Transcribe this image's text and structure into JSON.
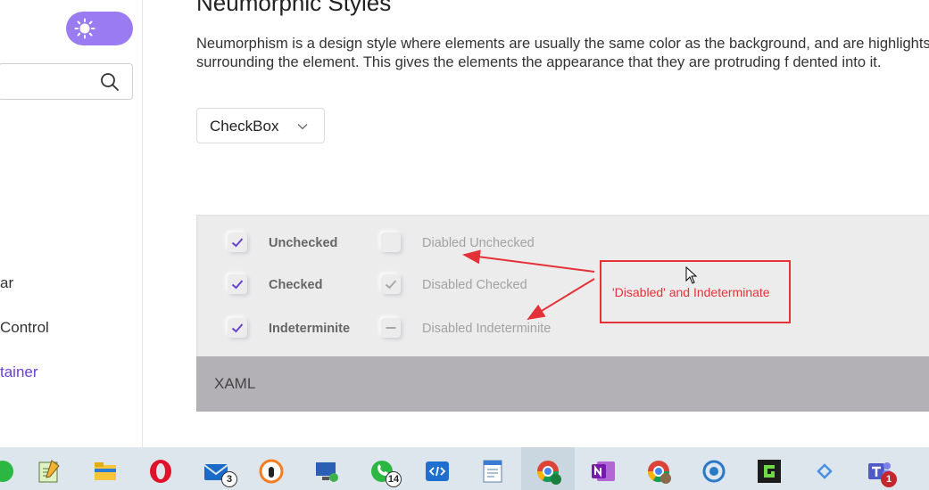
{
  "sidebar": {
    "search": {
      "placeholder": "",
      "value": ""
    },
    "items": [
      {
        "label": "ar"
      },
      {
        "label": "Control"
      },
      {
        "label": "tainer"
      }
    ]
  },
  "main": {
    "title": "Neumorphic Styles",
    "description": "Neumorphism is a design style where elements are usually the same color as the background, and are highlights surrounding the element. This gives the elements the appearance that they are protruding f dented into it.",
    "dropdown": {
      "selected": "CheckBox"
    }
  },
  "checkboxes": {
    "enabled": [
      {
        "label": "Unchecked",
        "state": "checked"
      },
      {
        "label": "Checked",
        "state": "checked"
      },
      {
        "label": "Indeterminite",
        "state": "checked"
      }
    ],
    "disabled": [
      {
        "label": "Diabled Unchecked",
        "state": "unchecked"
      },
      {
        "label": "Disabled Checked",
        "state": "checked"
      },
      {
        "label": "Disabled Indeterminite",
        "state": "indeterminate"
      }
    ]
  },
  "xaml": {
    "label": "XAML"
  },
  "annotation": {
    "text": "'Disabled' and Indeterminate",
    "color": "#e53238"
  },
  "colors": {
    "accent": "#9b7bf2",
    "check": "#6a3fd3",
    "panel": "#ececed",
    "xaml_bar": "#b3b1b5",
    "taskbar": "#dde6ed"
  },
  "taskbar": {
    "apps": [
      {
        "name": "whatsapp-partial-icon"
      },
      {
        "name": "notepad-icon"
      },
      {
        "name": "file-explorer-icon"
      },
      {
        "name": "opera-icon"
      },
      {
        "name": "mail-icon",
        "badge": "3"
      },
      {
        "name": "vpn-icon"
      },
      {
        "name": "remote-desktop-icon"
      },
      {
        "name": "whatsapp-icon",
        "badge": "14"
      },
      {
        "name": "code-editor-icon"
      },
      {
        "name": "wordpad-icon"
      },
      {
        "name": "chrome-profile-s-icon"
      },
      {
        "name": "onenote-icon"
      },
      {
        "name": "chrome-profile-icon"
      },
      {
        "name": "sync-icon"
      },
      {
        "name": "game-icon"
      },
      {
        "name": "power-automate-icon"
      },
      {
        "name": "teams-icon",
        "badge": "1"
      }
    ]
  }
}
